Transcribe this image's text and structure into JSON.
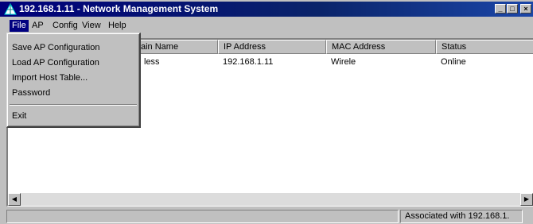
{
  "window": {
    "title": "192.168.1.11 - Network Management System"
  },
  "menubar": [
    {
      "label": "File",
      "mnemonic_index": 0
    },
    {
      "label": "AP",
      "mnemonic_index": 0
    },
    {
      "label": "Config",
      "mnemonic_index": 0
    },
    {
      "label": "View",
      "mnemonic_index": 0
    },
    {
      "label": "Help",
      "mnemonic_index": 0
    }
  ],
  "file_menu": [
    {
      "label": "Save AP Configuration"
    },
    {
      "label": "Load AP Configuration"
    },
    {
      "label": "Import  Host Table..."
    },
    {
      "label": "Password"
    },
    {
      "label": "Exit"
    }
  ],
  "table": {
    "columns": [
      "ain Name",
      "IP Address",
      "MAC Address",
      "Status"
    ],
    "row": [
      "less",
      "192.168.1.11",
      "Wirele",
      "Online"
    ]
  },
  "statusbar": {
    "right_text": "Associated with 192.168.1."
  },
  "icons": [
    "network-icon",
    "minimize-icon",
    "maximize-icon",
    "close-icon",
    "scroll-left-icon",
    "scroll-right-icon"
  ],
  "colors": {
    "titlebar": "#00007b",
    "highlight": "#000080",
    "face": "#c0c0c0"
  }
}
